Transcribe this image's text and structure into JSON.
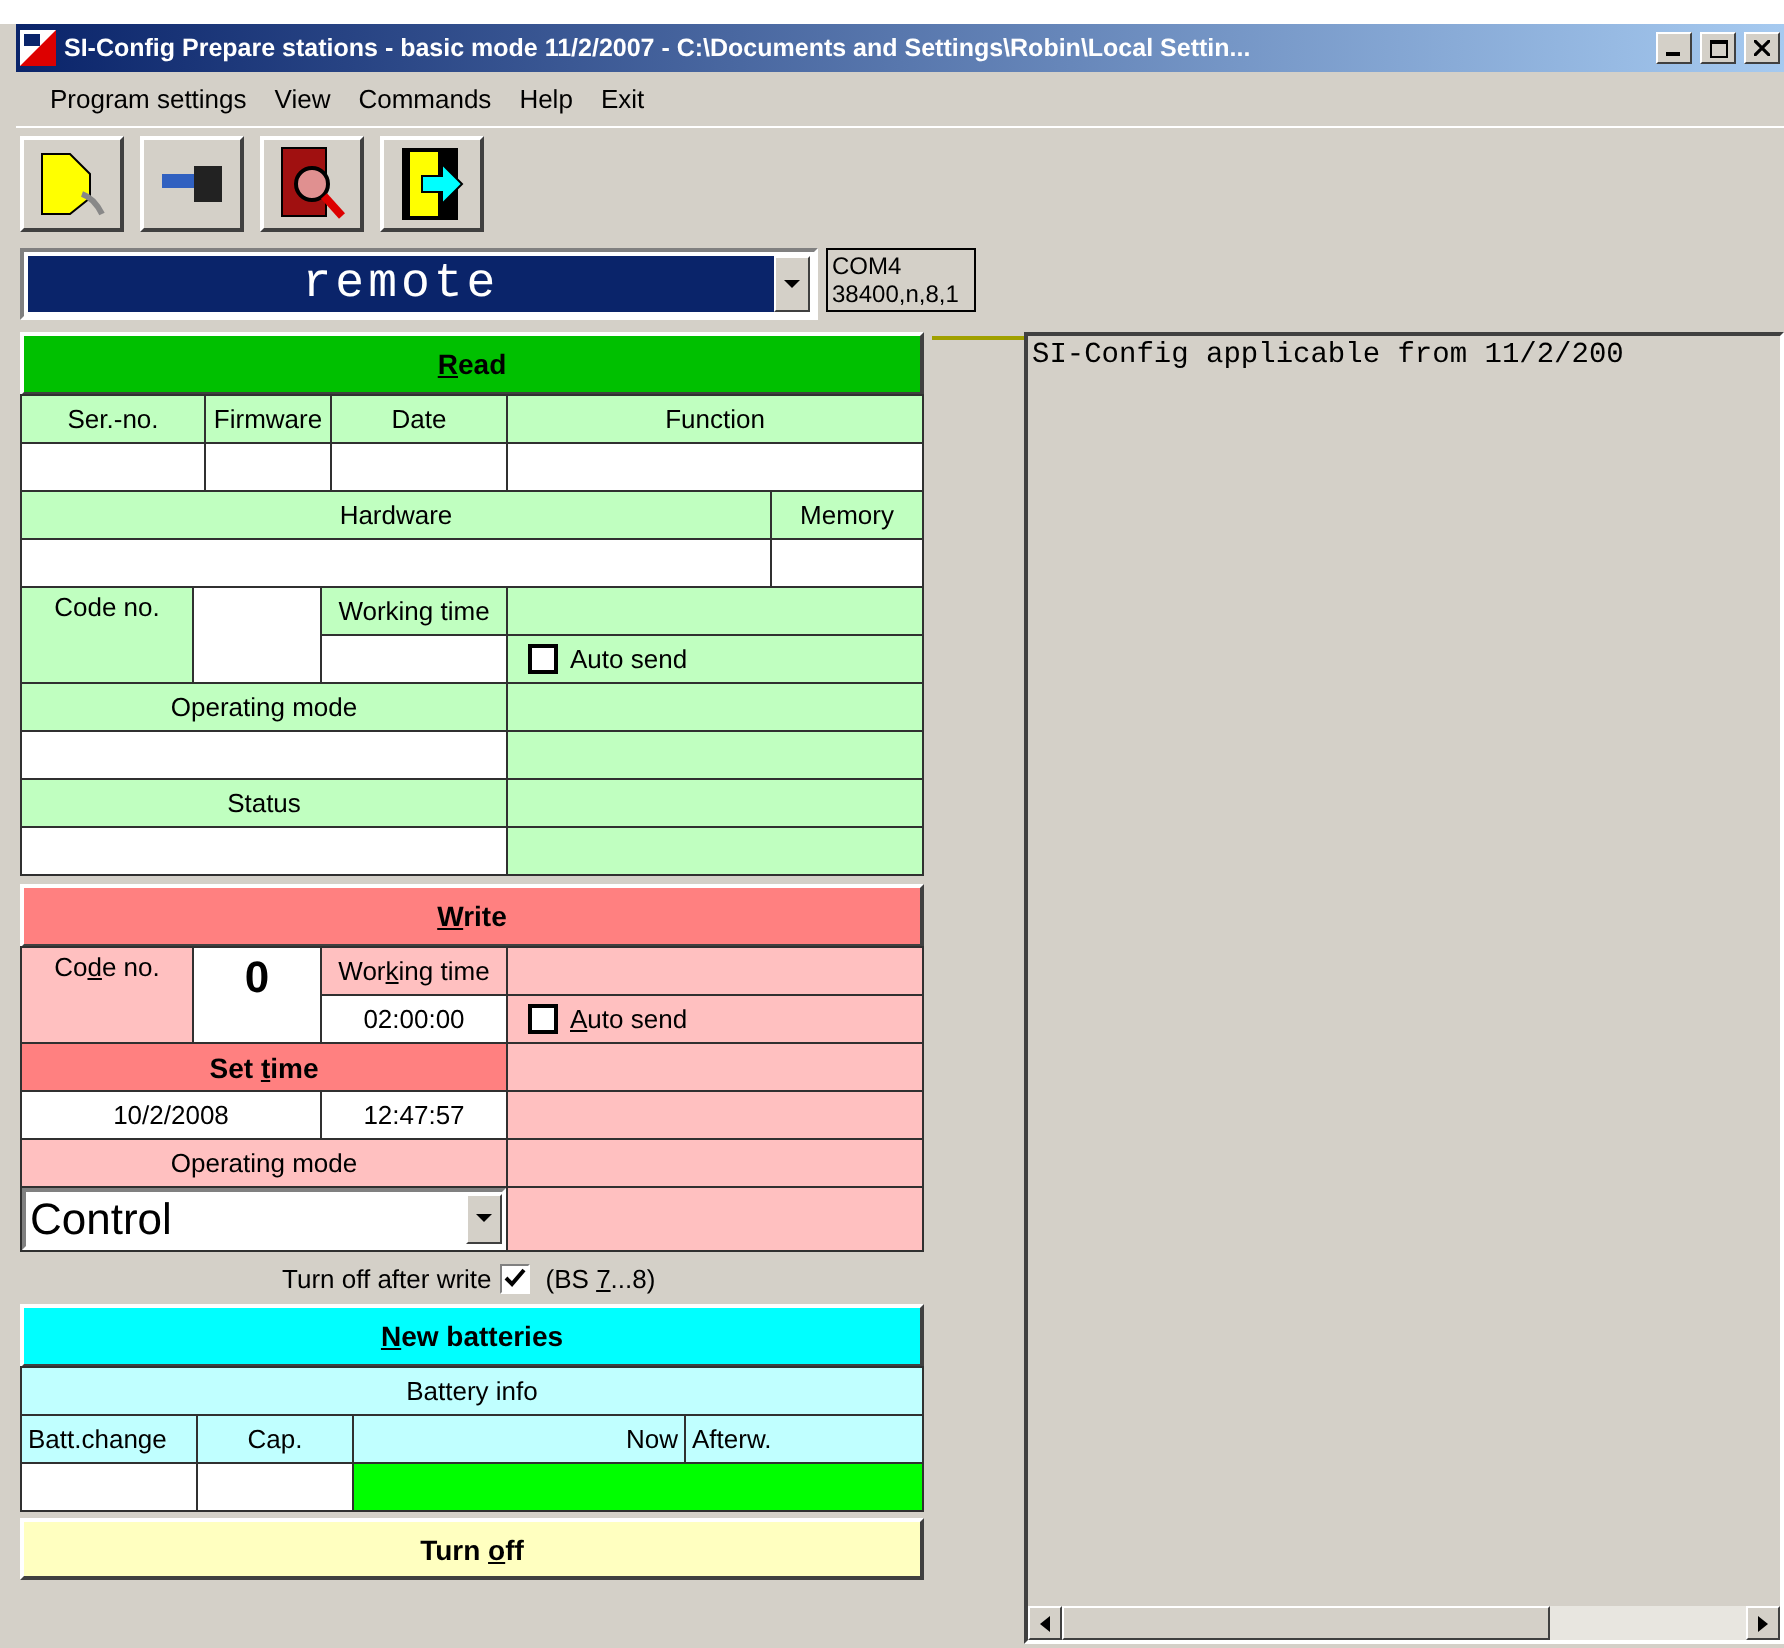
{
  "window": {
    "title": "SI-Config Prepare stations - basic mode 11/2/2007 - C:\\Documents and Settings\\Robin\\Local Settin..."
  },
  "menu": [
    "Program settings",
    "View",
    "Commands",
    "Help",
    "Exit"
  ],
  "station_select": {
    "value": "remote"
  },
  "port_info": [
    "COM4",
    "38400,n,8,1"
  ],
  "read": {
    "button": {
      "key": "R",
      "post": "ead"
    },
    "columns": [
      "Ser.-no.",
      "Firmware",
      "Date",
      "Function"
    ],
    "hardware_label": "Hardware",
    "memory_label": "Memory",
    "code_no_label": "Code no.",
    "working_time_label": "Working time",
    "auto_send": {
      "label": "Auto send",
      "checked": false
    },
    "operating_mode_label": "Operating mode",
    "status_label": "Status"
  },
  "write": {
    "button": {
      "key": "W",
      "post": "rite"
    },
    "code_no_label": {
      "pre": "Co",
      "key": "d",
      "post": "e no."
    },
    "code_no": "0",
    "working_time_label": {
      "pre": "Wor",
      "key": "k",
      "post": "ing time"
    },
    "working_time": "02:00:00",
    "auto_send": {
      "label": {
        "key": "A",
        "post": "uto send"
      },
      "checked": false
    },
    "set_time": {
      "pre": "Set ",
      "key": "t",
      "post": "ime"
    },
    "date": "10/2/2008",
    "time": "12:47:57",
    "operating_mode_label": "Operating mode",
    "operating_mode": "Control"
  },
  "turn_off_after_write": {
    "label": "Turn off after write",
    "checked": true,
    "note": {
      "pre": "(BS ",
      "key": "7",
      "post": "...8)"
    }
  },
  "batteries": {
    "button": {
      "key": "N",
      "post": "ew batteries"
    },
    "info_label": "Battery info",
    "columns": [
      "Batt.change",
      "Cap.",
      "Now",
      "Afterw."
    ]
  },
  "turn_off": {
    "pre": "Turn ",
    "key": "o",
    "post": "ff"
  },
  "log": [
    "SI-Config applicable from 11/2/200"
  ]
}
